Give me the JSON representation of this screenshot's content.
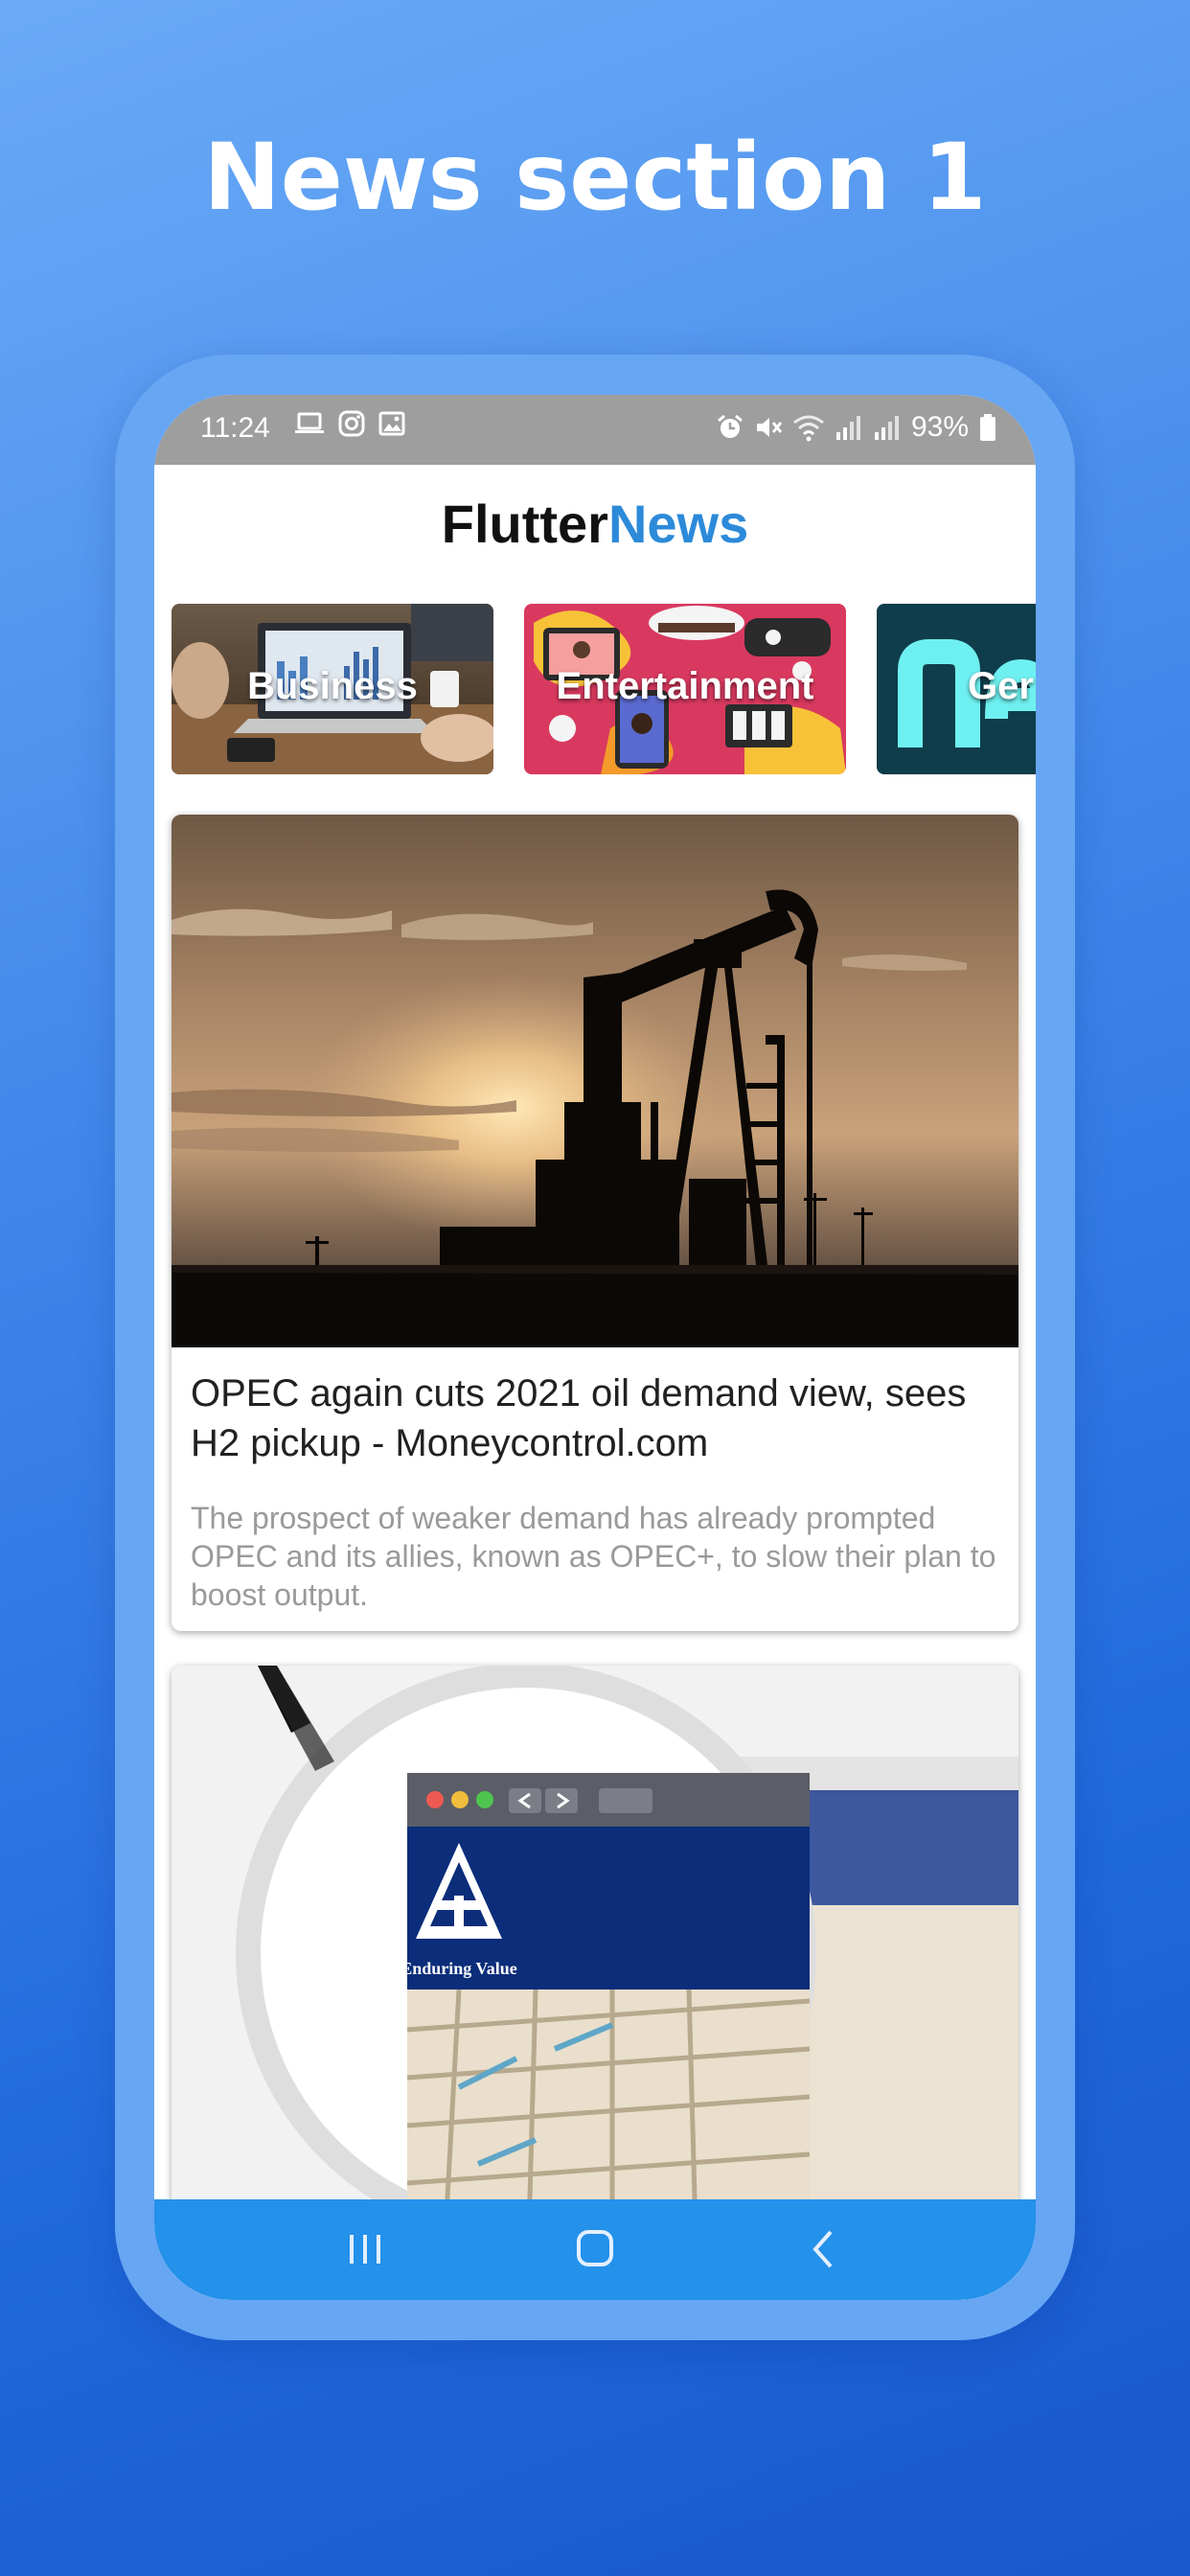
{
  "headline": "News section 1",
  "status_bar": {
    "time": "11:24",
    "battery": "93%",
    "left_icons": [
      "laptop-icon",
      "instagram-icon",
      "gallery-icon"
    ],
    "right_icons": [
      "alarm-icon",
      "mute-icon",
      "wifi-icon",
      "signal-icon",
      "signal-icon",
      "battery-icon"
    ]
  },
  "app_bar": {
    "title_part1": "Flutter",
    "title_part2": "News",
    "title_part1_color": "#111111",
    "title_part2_color": "#2d8ad9"
  },
  "categories": [
    {
      "label": "Business"
    },
    {
      "label": "Entertainment"
    },
    {
      "label": "Ger"
    }
  ],
  "articles": [
    {
      "title": "OPEC again cuts 2021 oil demand view, sees H2 pickup - Moneycontrol.com",
      "description": "The prospect of weaker demand has already prompted OPEC and its allies, known as OPEC+, to slow their plan to boost output.",
      "image": "oil-pump-sunset"
    },
    {
      "title": "",
      "description": "",
      "image": "itc-website-magnifier",
      "image_text": "Enduring Value"
    }
  ],
  "nav_bar": {
    "buttons": [
      "recent-apps-icon",
      "home-icon",
      "back-icon"
    ],
    "color": "#2491ea"
  },
  "colors": {
    "background_top": "#6aaaf6",
    "background_bottom": "#1858cc",
    "phone_frame": "#67a6f3",
    "status_bar": "#9e9e9e",
    "accent": "#2d8ad9"
  }
}
